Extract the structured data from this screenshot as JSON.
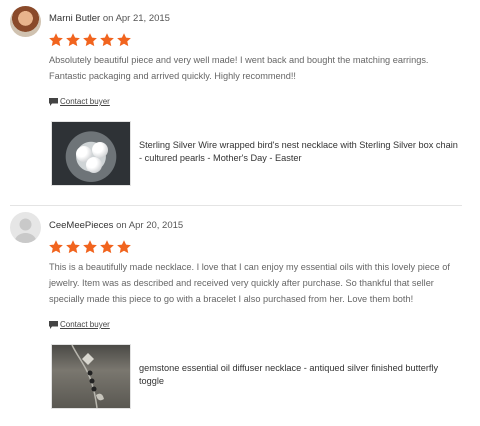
{
  "reviews": [
    {
      "reviewer": "Marni Butler",
      "on_label": "on",
      "date": "Apr 21, 2015",
      "rating": "5 stars",
      "text": "Absolutely beautiful piece and very well made! I went back and bought the matching earrings. Fantastic packaging and arrived quickly. Highly recommend!!",
      "contact_label": "Contact buyer",
      "item_title": "Sterling Silver Wire wrapped bird's nest necklace with Sterling Silver box chain - cultured pearls - Mother's Day - Easter"
    },
    {
      "reviewer": "CeeMeePieces",
      "on_label": "on",
      "date": "Apr 20, 2015",
      "rating": "5 stars",
      "text": "This is a beautifully made necklace. I love that I can enjoy my essential oils with this lovely piece of jewelry. Item was as described and received very quickly after purchase. So thankful that seller specially made this piece to go with a bracelet I also purchased from her. Love them both!",
      "contact_label": "Contact buyer",
      "item_title": "gemstone essential oil diffuser necklace - antiqued silver finished butterfly toggle"
    }
  ],
  "colors": {
    "star": "#f1641e",
    "text_muted": "#666666",
    "divider": "#e4e4e4"
  },
  "icons": {
    "star": "star-icon",
    "contact": "speech-bubble-icon"
  }
}
